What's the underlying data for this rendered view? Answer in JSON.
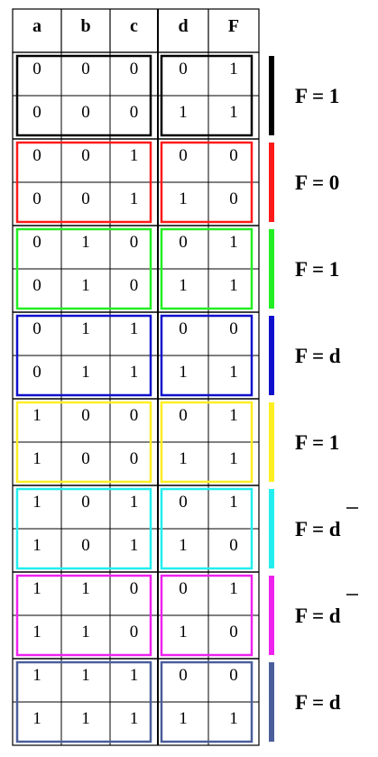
{
  "table": {
    "headers": [
      "a",
      "b",
      "c",
      "d",
      "F"
    ],
    "rows": [
      [
        "0",
        "0",
        "0",
        "0",
        "1"
      ],
      [
        "0",
        "0",
        "0",
        "1",
        "1"
      ],
      [
        "0",
        "0",
        "1",
        "0",
        "0"
      ],
      [
        "0",
        "0",
        "1",
        "1",
        "0"
      ],
      [
        "0",
        "1",
        "0",
        "0",
        "1"
      ],
      [
        "0",
        "1",
        "0",
        "1",
        "1"
      ],
      [
        "0",
        "1",
        "1",
        "0",
        "0"
      ],
      [
        "0",
        "1",
        "1",
        "1",
        "1"
      ],
      [
        "1",
        "0",
        "0",
        "0",
        "1"
      ],
      [
        "1",
        "0",
        "0",
        "1",
        "1"
      ],
      [
        "1",
        "0",
        "1",
        "0",
        "1"
      ],
      [
        "1",
        "0",
        "1",
        "1",
        "0"
      ],
      [
        "1",
        "1",
        "0",
        "0",
        "1"
      ],
      [
        "1",
        "1",
        "0",
        "1",
        "0"
      ],
      [
        "1",
        "1",
        "1",
        "0",
        "0"
      ],
      [
        "1",
        "1",
        "1",
        "1",
        "1"
      ]
    ]
  },
  "groups": [
    {
      "color": "#000000",
      "result": "F = 1",
      "bar": false
    },
    {
      "color": "#ff1a1a",
      "result": "F = 0",
      "bar": false
    },
    {
      "color": "#22ee22",
      "result": "F = 1",
      "bar": false
    },
    {
      "color": "#1010cc",
      "result": "F = d",
      "bar": false
    },
    {
      "color": "#ffee22",
      "result": "F = 1",
      "bar": false
    },
    {
      "color": "#22eeee",
      "result": "F = d",
      "bar": true
    },
    {
      "color": "#ee22ee",
      "result": "F = d",
      "bar": true
    },
    {
      "color": "#4a5e9a",
      "result": "F = d",
      "bar": false
    }
  ]
}
